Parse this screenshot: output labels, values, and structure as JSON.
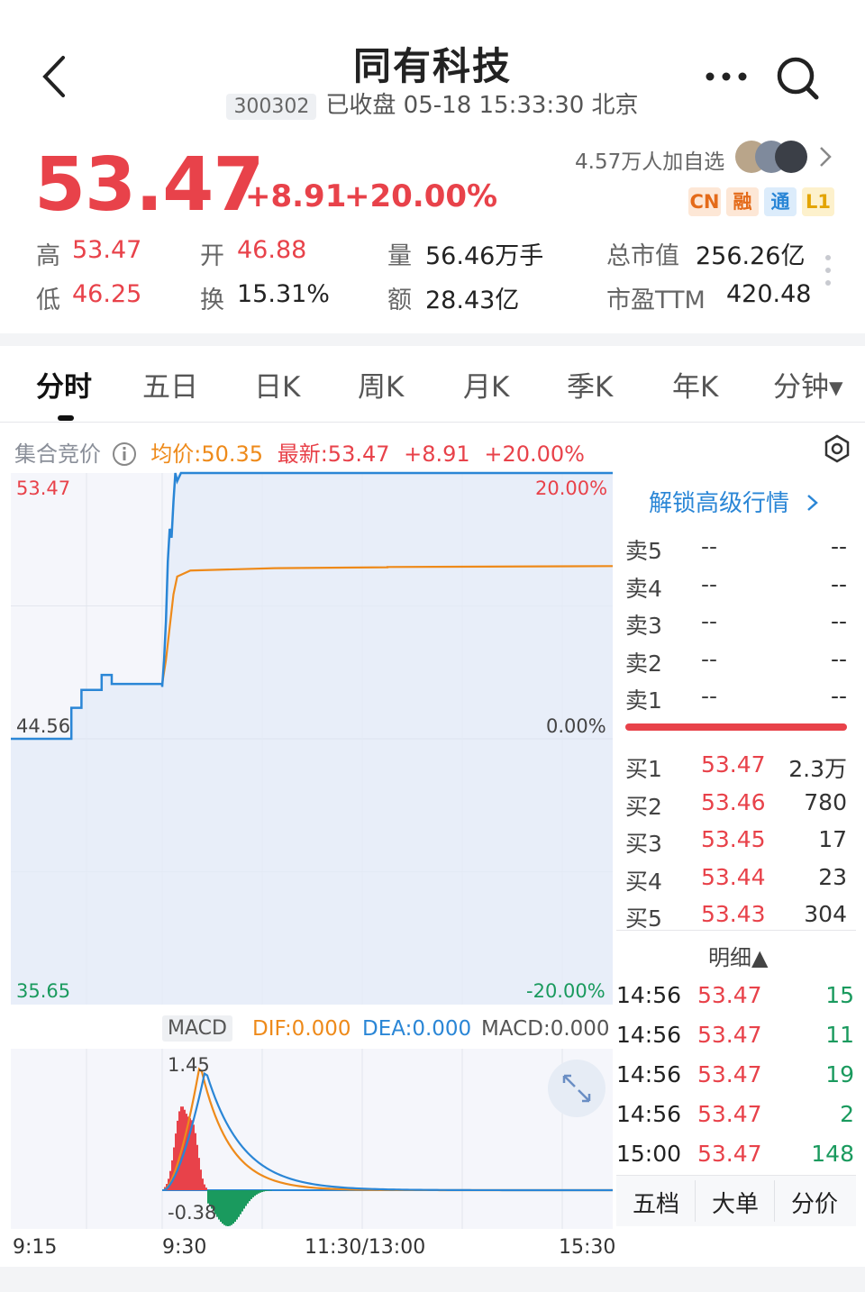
{
  "header": {
    "title": "同有科技",
    "code": "300302",
    "status": "已收盘 05-18 15:33:30 北京"
  },
  "quote": {
    "price": "53.47",
    "change": "+8.91",
    "change_pct": "+20.00%",
    "watchers": "4.57万人加自选",
    "tags": [
      "CN",
      "融",
      "通",
      "L1"
    ],
    "stats": {
      "high_label": "高",
      "high": "53.47",
      "open_label": "开",
      "open": "46.88",
      "vol_label": "量",
      "vol": "56.46万手",
      "mcap_label": "总市值",
      "mcap": "256.26亿",
      "low_label": "低",
      "low": "46.25",
      "turnover_label": "换",
      "turnover": "15.31%",
      "amount_label": "额",
      "amount": "28.43亿",
      "pe_label": "市盈TTM",
      "pe": "420.48"
    }
  },
  "tabs": [
    "分时",
    "五日",
    "日K",
    "周K",
    "月K",
    "季K",
    "年K",
    "分钟▾"
  ],
  "info": {
    "auction": "集合竞价",
    "avg": "均价:50.35",
    "latest": "最新:53.47",
    "chg": "+8.91",
    "chgp": "+20.00%"
  },
  "chart_data": {
    "type": "line",
    "x_ticks": [
      "9:15",
      "9:30",
      "11:30/13:00",
      "15:30"
    ],
    "y_left": [
      "53.47",
      "44.56",
      "35.65"
    ],
    "y_right": [
      "20.00%",
      "0.00%",
      "-20.00%"
    ],
    "prev_close": 44.56,
    "ylim": [
      35.65,
      53.47
    ],
    "series": [
      {
        "name": "最新",
        "color": "#2a86d6",
        "x": [
          "9:15",
          "9:20",
          "9:21",
          "9:22",
          "9:24",
          "9:25",
          "9:30",
          "9:31",
          "9:32",
          "9:33",
          "9:34",
          "9:35",
          "9:36",
          "9:37",
          "9:38",
          "9:40",
          "15:00"
        ],
        "y": [
          44.56,
          44.56,
          45.6,
          46.2,
          46.7,
          46.4,
          46.3,
          47.2,
          48.5,
          50.5,
          51.6,
          51.3,
          52.5,
          53.47,
          53.2,
          53.47,
          53.47
        ]
      },
      {
        "name": "均价",
        "color": "#ee8a1a",
        "x": [
          "9:30",
          "9:32",
          "9:34",
          "9:36",
          "9:38",
          "9:45",
          "10:30",
          "11:30",
          "13:00",
          "15:00"
        ],
        "y": [
          46.4,
          47.2,
          48.3,
          49.4,
          50.0,
          50.2,
          50.28,
          50.31,
          50.32,
          50.35
        ]
      }
    ]
  },
  "macd": {
    "label": "MACD",
    "dif": "DIF:0.000",
    "dea": "DEA:0.000",
    "macd": "MACD:0.000",
    "max_label": "1.45",
    "min_label": "-0.38"
  },
  "orderbook": {
    "unlock": "解锁高级行情",
    "asks": [
      {
        "name": "卖5",
        "price": "--",
        "vol": "--"
      },
      {
        "name": "卖4",
        "price": "--",
        "vol": "--"
      },
      {
        "name": "卖3",
        "price": "--",
        "vol": "--"
      },
      {
        "name": "卖2",
        "price": "--",
        "vol": "--"
      },
      {
        "name": "卖1",
        "price": "--",
        "vol": "--"
      }
    ],
    "bids": [
      {
        "name": "买1",
        "price": "53.47",
        "vol": "2.3万"
      },
      {
        "name": "买2",
        "price": "53.46",
        "vol": "780"
      },
      {
        "name": "买3",
        "price": "53.45",
        "vol": "17"
      },
      {
        "name": "买4",
        "price": "53.44",
        "vol": "23"
      },
      {
        "name": "买5",
        "price": "53.43",
        "vol": "304"
      }
    ],
    "detail_label": "明细▲",
    "ticks": [
      {
        "time": "14:56",
        "price": "53.47",
        "vol": "15"
      },
      {
        "time": "14:56",
        "price": "53.47",
        "vol": "11"
      },
      {
        "time": "14:56",
        "price": "53.47",
        "vol": "19"
      },
      {
        "time": "14:56",
        "price": "53.47",
        "vol": "2"
      },
      {
        "time": "15:00",
        "price": "53.47",
        "vol": "148"
      }
    ],
    "bottom_tabs": [
      "五档",
      "大单",
      "分价"
    ]
  },
  "colors": {
    "up": "#e8424a",
    "down": "#1a9a5e",
    "price_line": "#2a86d6",
    "avg_line": "#ee8a1a"
  }
}
